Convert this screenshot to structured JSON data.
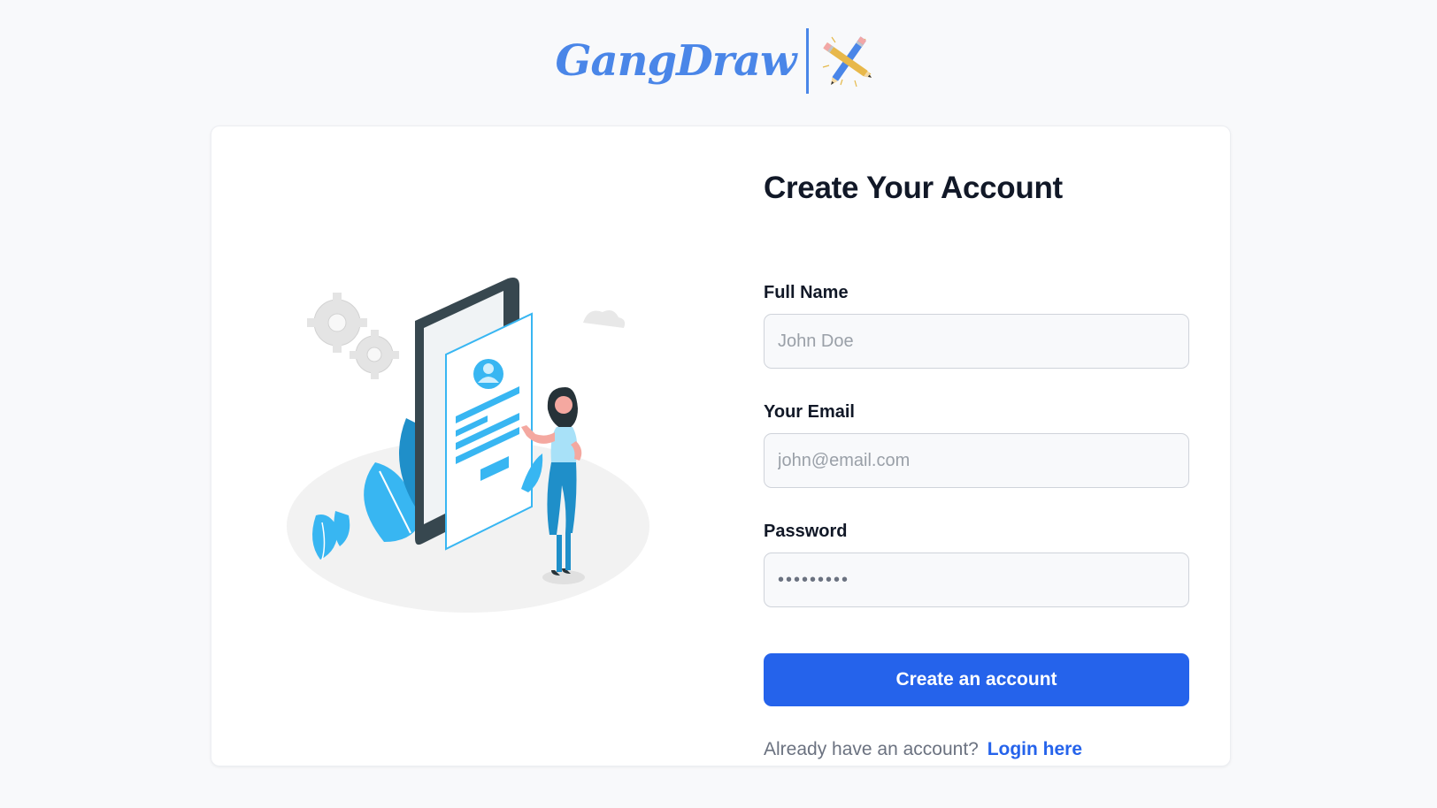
{
  "brand": {
    "name": "GangDraw",
    "color": "#4a86e8",
    "icon": "crossed-pencils-icon"
  },
  "illustration": {
    "icon": "signup-illustration"
  },
  "form": {
    "title": "Create Your Account",
    "fields": [
      {
        "label": "Full Name",
        "placeholder": "John Doe",
        "value": ""
      },
      {
        "label": "Your Email",
        "placeholder": "john@email.com",
        "value": ""
      },
      {
        "label": "Password",
        "placeholder": "",
        "value": "•••••••••"
      }
    ],
    "submit_label": "Create an account",
    "login_prompt": "Already have an account?",
    "login_link": "Login here"
  },
  "colors": {
    "accent": "#2563eb",
    "background": "#f8f9fb"
  }
}
